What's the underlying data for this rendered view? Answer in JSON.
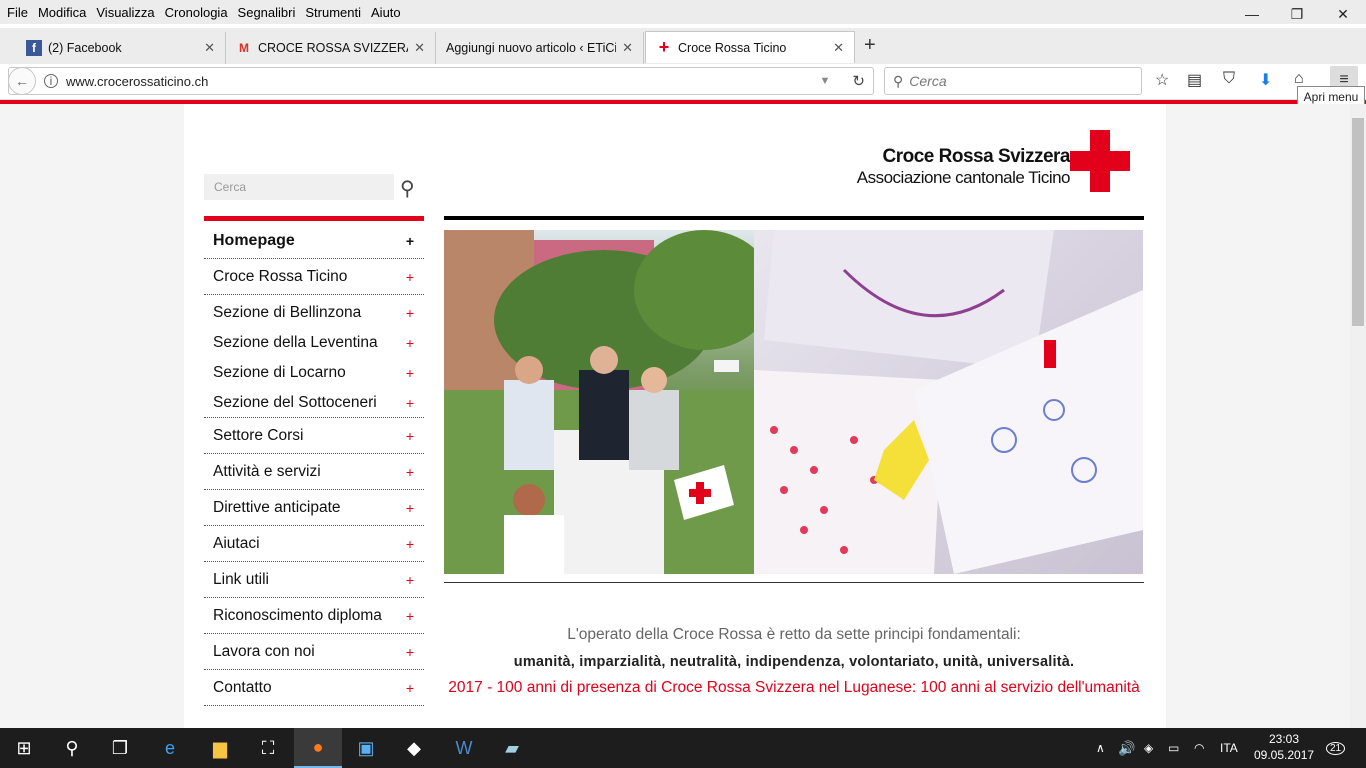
{
  "menu": [
    "File",
    "Modifica",
    "Visualizza",
    "Cronologia",
    "Segnalibri",
    "Strumenti",
    "Aiuto"
  ],
  "window": {
    "minimize": "—",
    "restore": "❐",
    "close": "✕"
  },
  "tabs": [
    {
      "title": "(2) Facebook",
      "favicon": "f"
    },
    {
      "title": "CROCE ROSSA SVIZZERA - A",
      "favicon": "M"
    },
    {
      "title": "Aggiungi nuovo articolo ‹ ETiCin",
      "favicon": ""
    },
    {
      "title": "Croce Rossa Ticino",
      "favicon": "+"
    }
  ],
  "address": {
    "url": "www.crocerossaticino.ch"
  },
  "browser_search": {
    "placeholder": "Cerca"
  },
  "tooltip": "Apri menu",
  "site": {
    "search_placeholder": "Cerca",
    "logo_line1": "Croce Rossa Svizzera",
    "logo_line2": "Associazione cantonale Ticino",
    "nav": [
      {
        "label": "Homepage"
      },
      {
        "label": "Croce Rossa Ticino"
      },
      {
        "label": "Sezione di Bellinzona"
      },
      {
        "label": "Sezione della Leventina"
      },
      {
        "label": "Sezione di Locarno"
      },
      {
        "label": "Sezione del Sottoceneri"
      },
      {
        "label": "Settore Corsi"
      },
      {
        "label": "Attività e servizi"
      },
      {
        "label": "Direttive anticipate"
      },
      {
        "label": "Aiutaci"
      },
      {
        "label": "Link utili"
      },
      {
        "label": "Riconoscimento diploma"
      },
      {
        "label": "Lavora con noi"
      },
      {
        "label": "Contatto"
      }
    ],
    "plus": "+",
    "principles_intro": "L'operato della Croce Rossa è retto da sette principi fondamentali:",
    "principles_list": "umanità, imparzialità, neutralità, indipendenza, volontariato, unità, universalità.",
    "anniversary": "2017 - 100 anni di presenza di Croce Rossa Svizzera nel Luganese: 100 anni al servizio dell'umanità"
  },
  "taskbar": {
    "language": "ITA",
    "time": "23:03",
    "date": "09.05.2017",
    "notifications": "21"
  },
  "colors": {
    "brand_red": "#e2001a"
  }
}
